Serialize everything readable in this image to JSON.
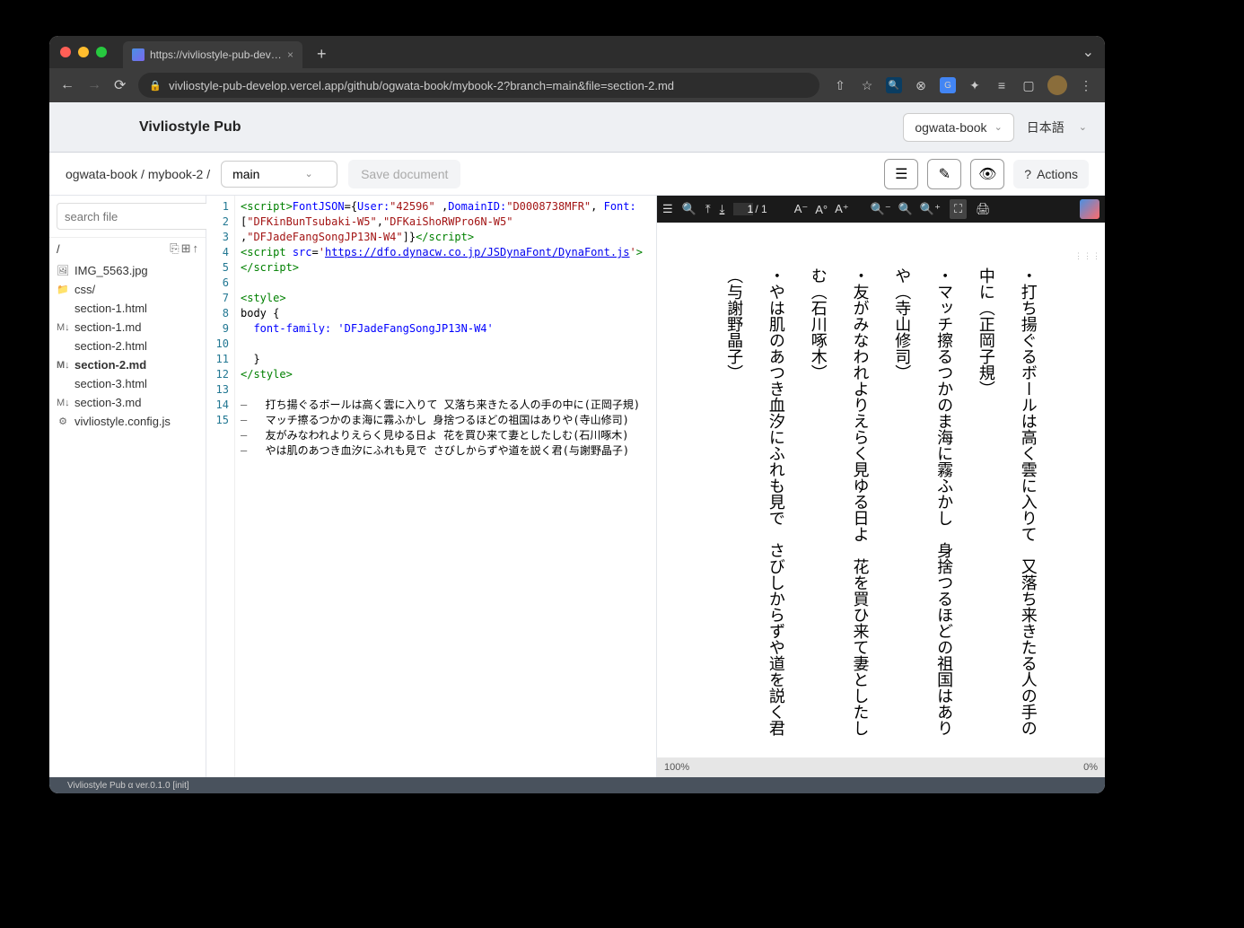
{
  "browser": {
    "tab_title": "https://vivliostyle-pub-develop",
    "url": "vivliostyle-pub-develop.vercel.app/github/ogwata-book/mybook-2?branch=main&file=section-2.md"
  },
  "header": {
    "brand": "Vivliostyle Pub",
    "repo": "ogwata-book",
    "language": "日本語"
  },
  "toolbar": {
    "breadcrumb": "ogwata-book / mybook-2 /",
    "branch": "main",
    "save_label": "Save document",
    "actions_label": "Actions"
  },
  "sidebar": {
    "search_placeholder": "search file",
    "root": "/",
    "files": [
      {
        "icon": "🖼",
        "name": "IMG_5563.jpg"
      },
      {
        "icon": "📁",
        "name": "css/"
      },
      {
        "icon": "</>",
        "name": "section-1.html"
      },
      {
        "icon": "M↓",
        "name": "section-1.md"
      },
      {
        "icon": "</>",
        "name": "section-2.html"
      },
      {
        "icon": "M↓",
        "name": "section-2.md",
        "active": true
      },
      {
        "icon": "</>",
        "name": "section-3.html"
      },
      {
        "icon": "M↓",
        "name": "section-3.md"
      },
      {
        "icon": "⚙",
        "name": "vivliostyle.config.js"
      }
    ]
  },
  "editor": {
    "lines": [
      1,
      2,
      3,
      4,
      5,
      6,
      7,
      8,
      9,
      10,
      11,
      12,
      13,
      14,
      15
    ]
  },
  "code": {
    "user": "\"42596\"",
    "domain": "\"D0008738MFR\"",
    "font1": "\"DFKinBunTsubaki-W5\"",
    "font2": "\"DFKaiShoRWPro6N-W5\"",
    "font3": "\"DFJadeFangSongJP13N-W4\"",
    "script_url": "https://dfo.dynacw.co.jp/JSDynaFont/DynaFont.js",
    "style_open": "<style>",
    "body_open": "body {",
    "font_family": "  font-family: 'DFJadeFangSongJP13N-W4'",
    "close_brace": "  }",
    "style_close": "</style>",
    "poems": [
      "打ち揚ぐるボールは高く雲に入りて 又落ち来きたる人の手の中に(正岡子規)",
      "マッチ擦るつかのま海に霧ふかし 身捨つるほどの祖国はありや(寺山修司)",
      "友がみなわれよりえらく見ゆる日よ 花を買ひ来て妻としたしむ(石川啄木)",
      "やは肌のあつき血汐にふれも見で さびしからずや道を説く君(与謝野晶子)"
    ]
  },
  "preview": {
    "page_current": "1",
    "page_total": "/ 1",
    "zoom": "100%",
    "zoom_right": "0%",
    "poems": [
      "・打ち揚ぐるボールは高く雲に入りて　又落ち来きたる人の手の中に（正岡子規）",
      "・マッチ擦るつかのま海に霧ふかし　身捨つるほどの祖国はありや（寺山修司）",
      "・友がみなわれよりえらく見ゆる日よ　花を買ひ来て妻としたしむ（石川啄木）",
      "・やは肌のあつき血汐にふれも見で　さびしからずや道を説く君（与謝野晶子）"
    ]
  },
  "status": "Vivliostyle Pub α ver.0.1.0 [init]"
}
